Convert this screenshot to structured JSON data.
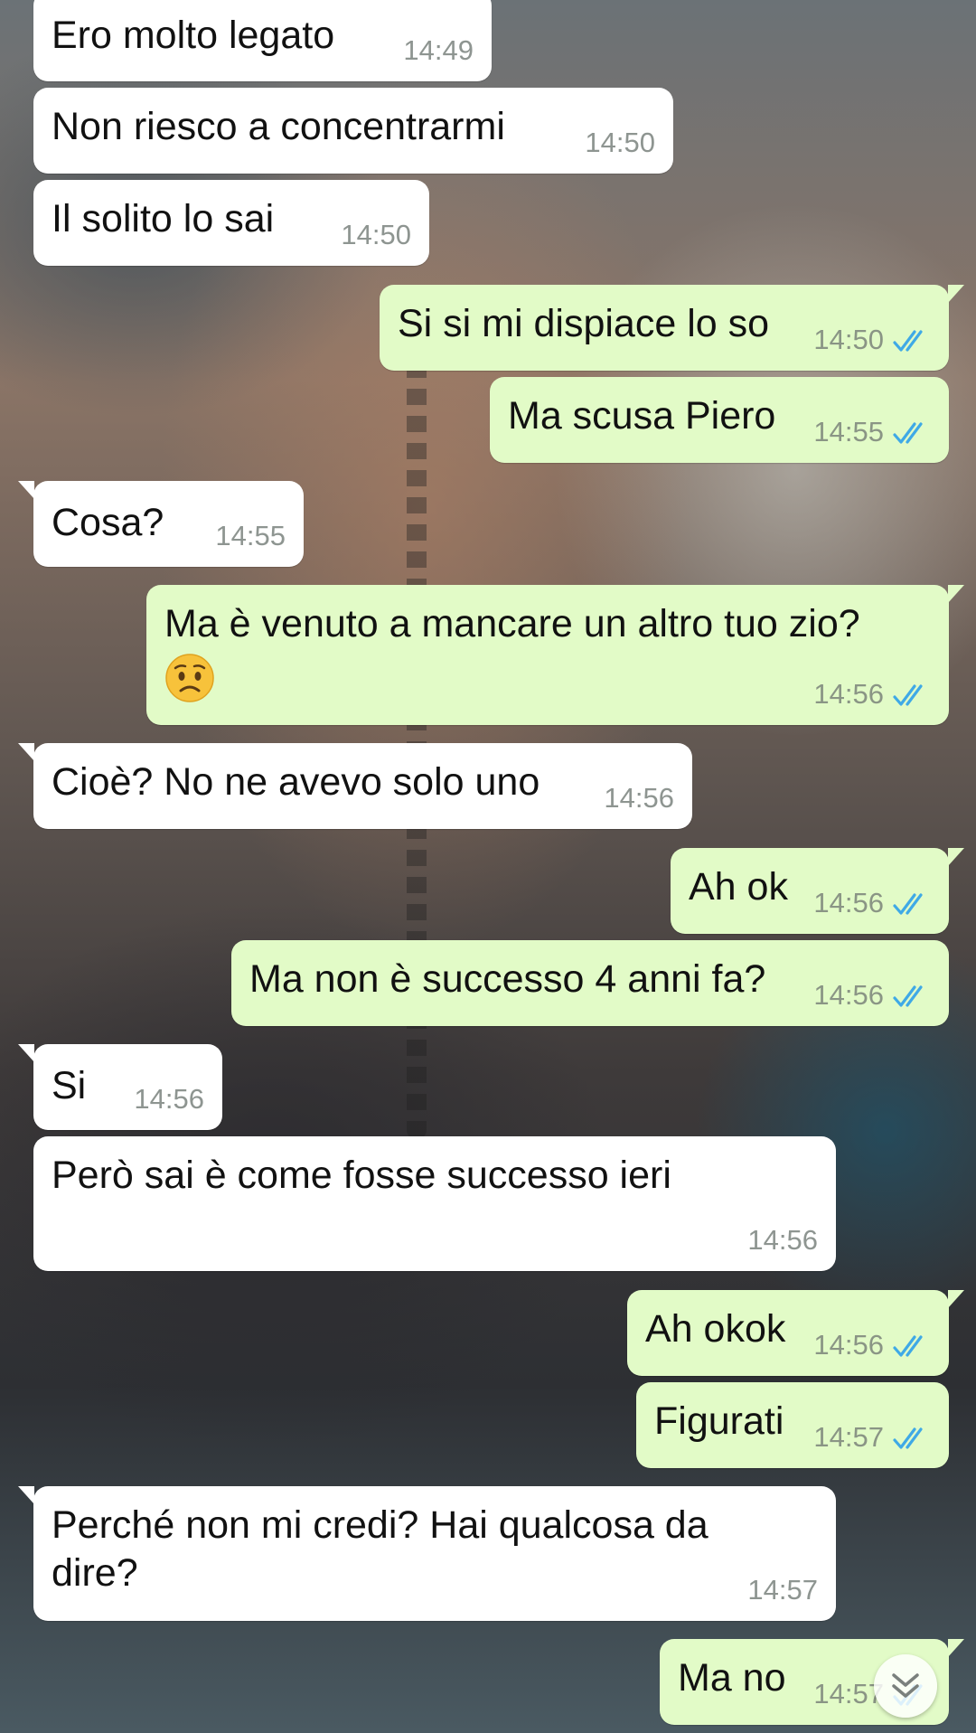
{
  "colors": {
    "incoming_bubble": "#ffffff",
    "outgoing_bubble": "#e2fbc7",
    "read_ticks": "#3fa9e6",
    "timestamp": "#8e9591"
  },
  "messages": [
    {
      "direction": "incoming",
      "text": "Ero molto legato",
      "time": "14:49"
    },
    {
      "direction": "incoming",
      "text": "Non riesco a concentrarmi",
      "time": "14:50"
    },
    {
      "direction": "incoming",
      "text": "Il solito lo sai",
      "time": "14:50"
    },
    {
      "direction": "outgoing",
      "text": "Si si mi dispiace lo so",
      "time": "14:50",
      "status": "read"
    },
    {
      "direction": "outgoing",
      "text": "Ma scusa Piero",
      "time": "14:55",
      "status": "read"
    },
    {
      "direction": "incoming",
      "text": "Cosa?",
      "time": "14:55"
    },
    {
      "direction": "outgoing",
      "text": "Ma è venuto a mancare un altro tuo zio?",
      "emoji": "worried-face-icon",
      "time": "14:56",
      "status": "read"
    },
    {
      "direction": "incoming",
      "text": "Cioè? No ne avevo solo uno",
      "time": "14:56"
    },
    {
      "direction": "outgoing",
      "text": "Ah ok",
      "time": "14:56",
      "status": "read"
    },
    {
      "direction": "outgoing",
      "text": "Ma non è successo 4 anni fa?",
      "time": "14:56",
      "status": "read"
    },
    {
      "direction": "incoming",
      "text": "Si",
      "time": "14:56"
    },
    {
      "direction": "incoming",
      "text": "Però sai è come fosse successo ieri",
      "time": "14:56"
    },
    {
      "direction": "outgoing",
      "text": "Ah okok",
      "time": "14:56",
      "status": "read"
    },
    {
      "direction": "outgoing",
      "text": "Figurati",
      "time": "14:57",
      "status": "read"
    },
    {
      "direction": "incoming",
      "text": "Perché non mi credi? Hai qualcosa da dire?",
      "time": "14:57"
    },
    {
      "direction": "outgoing",
      "text": "Ma no",
      "time": "14:57",
      "status": "read"
    }
  ],
  "scroll_button": {
    "icon": "double-chevron-down-icon"
  }
}
